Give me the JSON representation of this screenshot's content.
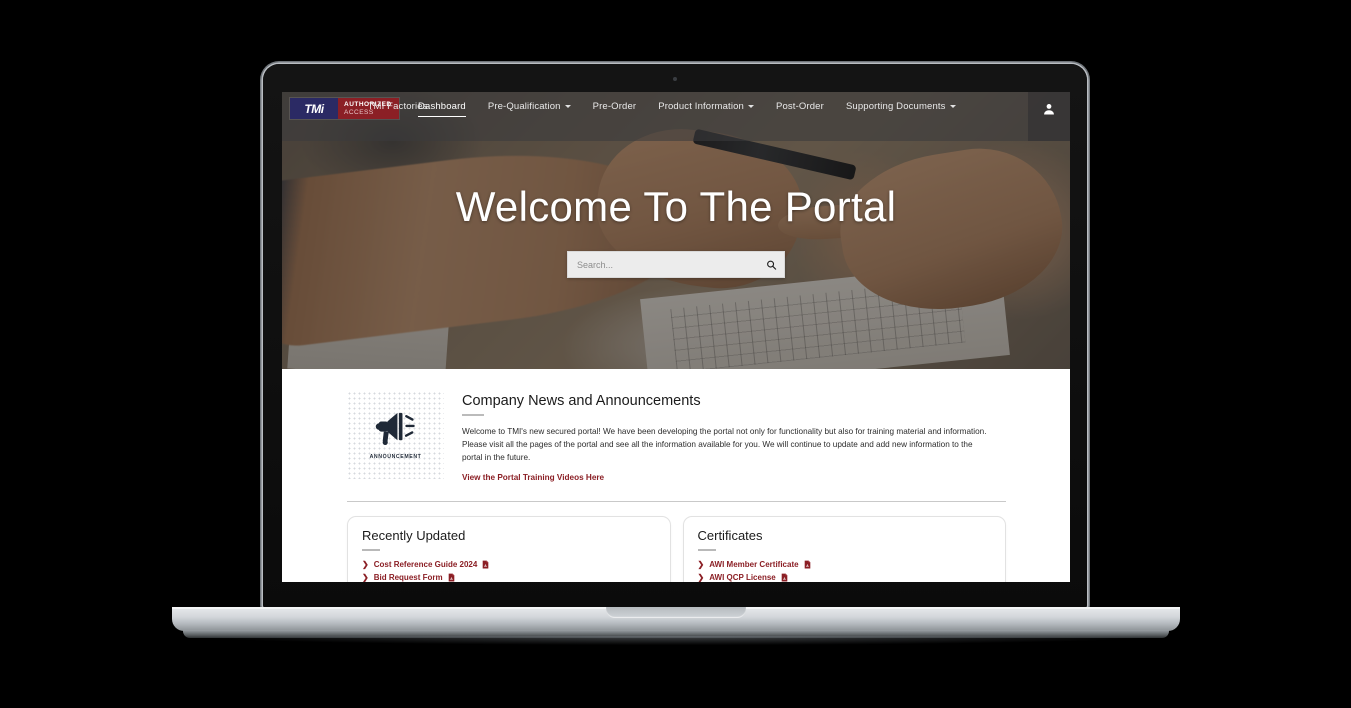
{
  "brand": {
    "logo_main": "TMi",
    "logo_line1": "AUTHORIZED",
    "logo_line2": "ACCESS",
    "navy": "#2b2a64",
    "dark_red": "#8b1f25"
  },
  "nav": {
    "items": [
      {
        "label": "Dashboard",
        "has_caret": false,
        "active": true
      },
      {
        "label": "Pre-Qualification",
        "has_caret": true,
        "active": false
      },
      {
        "label": "Pre-Order",
        "has_caret": false,
        "active": false
      },
      {
        "label": "Product Information",
        "has_caret": true,
        "active": false
      },
      {
        "label": "Post-Order",
        "has_caret": false,
        "active": false
      },
      {
        "label": "Supporting Documents",
        "has_caret": true,
        "active": false
      },
      {
        "label": "TMI Factories",
        "has_caret": false,
        "active": false
      }
    ],
    "avatar_icon": "user-icon"
  },
  "hero": {
    "title": "Welcome To The Portal",
    "search_placeholder": "Search...",
    "search_value": "",
    "search_icon": "search-icon"
  },
  "news": {
    "icon_name": "megaphone-icon",
    "icon_caption": "ANNOUNCEMENT",
    "title": "Company News and Announcements",
    "body": "Welcome to TMI's new secured portal! We have been developing the portal not only for functionality but also for training material and information. Please visit all the pages of the portal and see all the information available for you. We will continue to update and add new information to the portal in the future.",
    "link": "View the Portal Training Videos Here"
  },
  "cards": [
    {
      "title": "Recently Updated",
      "links": [
        {
          "label": "Cost Reference Guide 2024",
          "file_icon": "pdf-icon"
        },
        {
          "label": "Bid Request Form",
          "file_icon": "pdf-icon"
        }
      ]
    },
    {
      "title": "Certificates",
      "links": [
        {
          "label": "AWI Member Certificate",
          "file_icon": "pdf-icon"
        },
        {
          "label": "AWI QCP License",
          "file_icon": "pdf-icon"
        }
      ]
    }
  ]
}
